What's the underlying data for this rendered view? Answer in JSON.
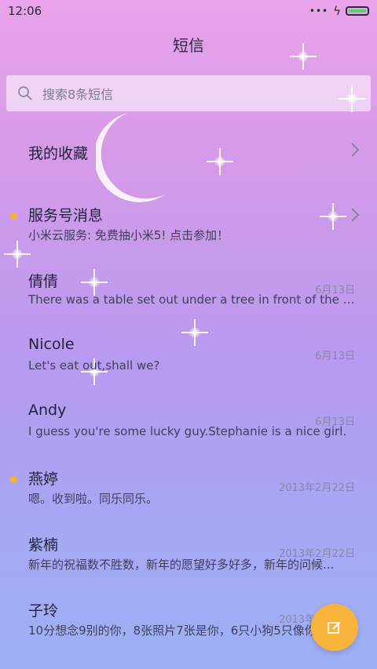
{
  "status": {
    "time": "12:06"
  },
  "header": {
    "title": "短信"
  },
  "search": {
    "placeholder": "搜索8条短信"
  },
  "favorites": {
    "label": "我的收藏"
  },
  "conversations": [
    {
      "name": "服务号消息",
      "preview": "小米云服务: 免费抽小米5! 点击参加！",
      "date": "",
      "unread": true
    },
    {
      "name": "倩倩",
      "preview": "There was a table set out under a tree in front of the ho...",
      "date": "6月13日",
      "unread": false
    },
    {
      "name": "Nicole",
      "preview": "Let's eat out,shall we?",
      "date": "6月13日",
      "unread": false
    },
    {
      "name": "Andy",
      "preview": "I guess you're some lucky guy.Stephanie is a nice girl.",
      "date": "6月13日",
      "unread": false
    },
    {
      "name": "燕婷",
      "preview": "嗯。收到啦。同乐同乐。",
      "date": "2013年2月22日",
      "unread": true
    },
    {
      "name": "紫楠",
      "preview": "新年的祝福数不胜数，新年的愿望好多好多，新年的问候...",
      "date": "2013年2月22日",
      "unread": false
    },
    {
      "name": "子玲",
      "preview": "10分想念9别的你，8张照片7张是你，6只小狗5只像你",
      "date": "2013年2月22日",
      "unread": false
    }
  ],
  "colors": {
    "accent": "#f8b43a",
    "unread_dot": "#f6b22b",
    "battery": "#4cd964"
  },
  "icons": {
    "search": "search-icon",
    "chevron": "chevron-right-icon",
    "compose": "compose-icon"
  }
}
